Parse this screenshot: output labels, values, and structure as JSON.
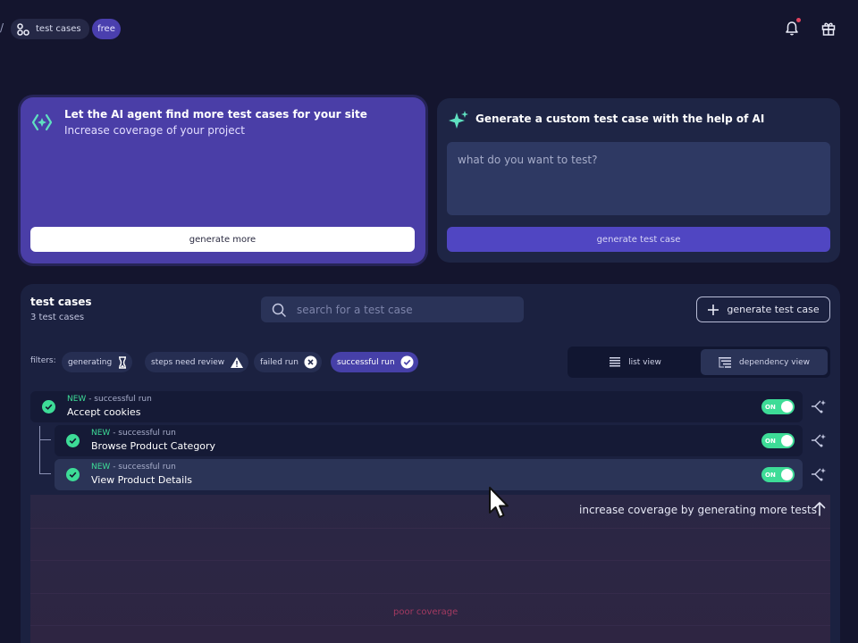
{
  "topbar": {
    "separator": "/",
    "project_label": "test cases",
    "plan_badge": "free",
    "icons": [
      "bell-icon",
      "gift-icon"
    ]
  },
  "agent_card": {
    "title": "Let the AI agent find more test cases for your site",
    "subtitle": "Increase coverage of your project",
    "button_label": "generate more"
  },
  "custom_card": {
    "title": "Generate a custom test case with the help of AI",
    "input_placeholder": "what do you want to test?",
    "button_label": "generate test case"
  },
  "test_cases": {
    "title": "test cases",
    "count": "3 test cases",
    "search_placeholder": "search for a test case",
    "generate_button": "generate test case",
    "filters_label": "filters:",
    "filters": [
      {
        "label": "generating",
        "icon": "hourglass-icon"
      },
      {
        "label": "steps need review",
        "icon": "warning-icon"
      },
      {
        "label": "failed run",
        "icon": "x-circle-icon"
      },
      {
        "label": "successful run",
        "icon": "check-circle-icon",
        "active": true
      }
    ],
    "views": {
      "list": "list view",
      "dependency": "dependency view",
      "selected": "dependency"
    },
    "rows": [
      {
        "badge": "NEW",
        "status": " - successful run",
        "name": "Accept cookies",
        "toggle": "ON"
      },
      {
        "badge": "NEW",
        "status": " - successful run",
        "name": "Browse Product Category",
        "toggle": "ON"
      },
      {
        "badge": "NEW",
        "status": " - successful run",
        "name": "View Product Details",
        "toggle": "ON"
      }
    ]
  },
  "coverage": {
    "hint": "increase coverage by generating more tests",
    "level": "poor coverage"
  },
  "colors": {
    "accent": "#5046c2",
    "success": "#3ddc97",
    "danger": "#a33a61",
    "background": "#14152e"
  }
}
